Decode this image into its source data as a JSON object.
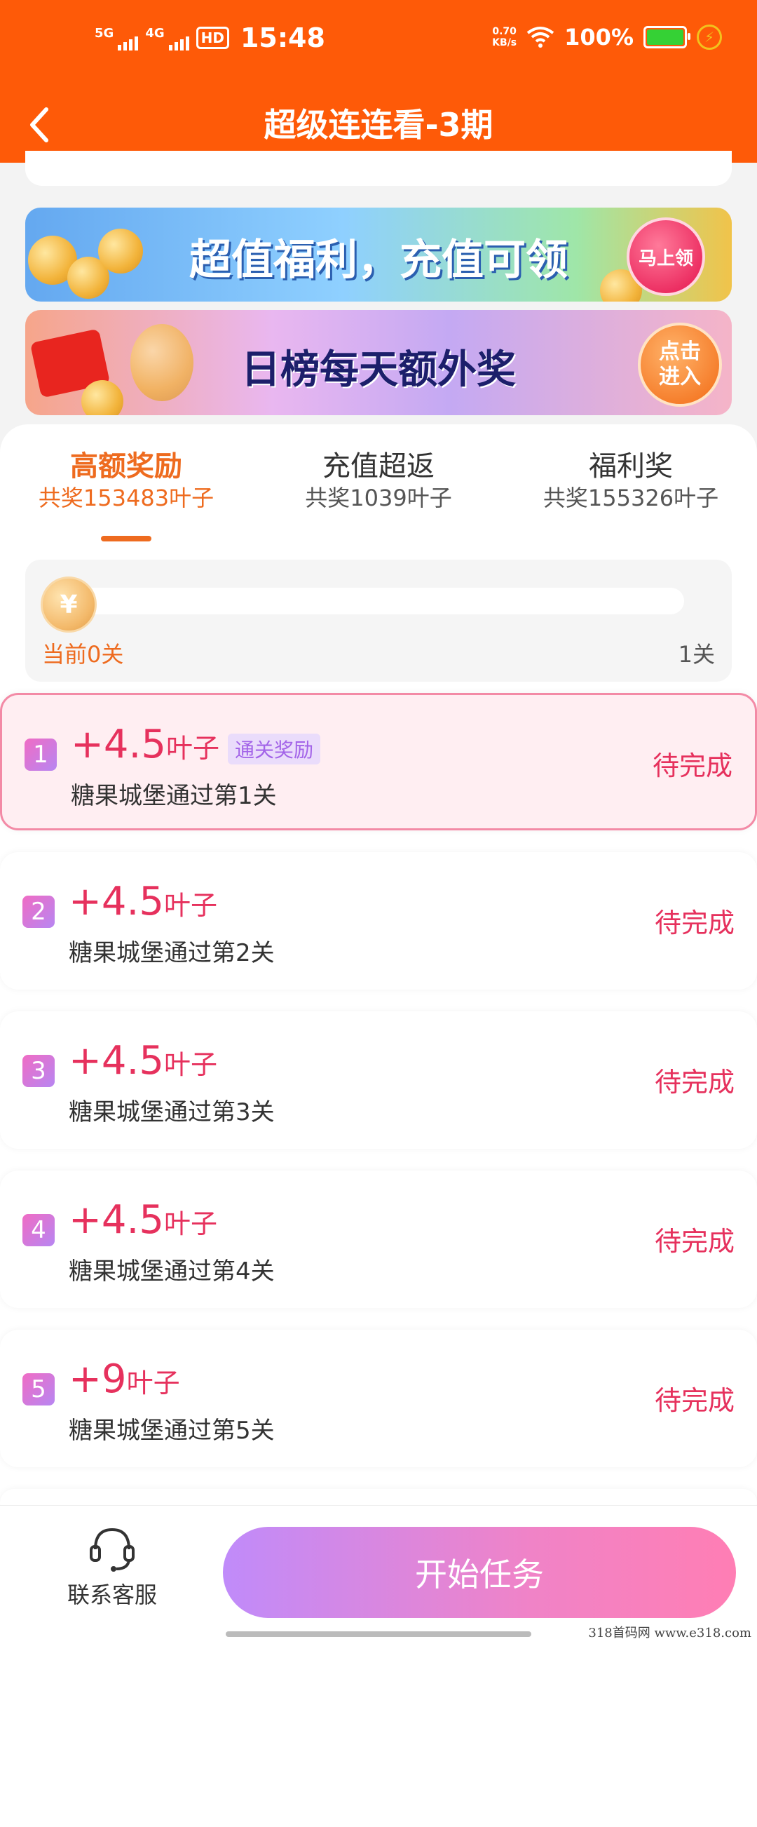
{
  "status_bar": {
    "net1": "5G",
    "net2": "4G",
    "hd": "HD",
    "time": "15:48",
    "speed_value": "0.70",
    "speed_unit": "KB/s",
    "battery": "100%"
  },
  "header": {
    "title": "超级连连看-3期"
  },
  "banners": [
    {
      "text": "超值福利，充值可领",
      "badge": "马上领"
    },
    {
      "text": "日榜每天额外奖",
      "badge_line1": "点击",
      "badge_line2": "进入"
    }
  ],
  "tabs": [
    {
      "label": "高额奖励",
      "sub": "共奖153483叶子"
    },
    {
      "label": "充值超返",
      "sub": "共奖1039叶子"
    },
    {
      "label": "福利奖",
      "sub": "共奖155326叶子"
    }
  ],
  "progress": {
    "current": "当前0关",
    "target": "1关",
    "coin_symbol": "¥",
    "fraction": 0
  },
  "tasks": [
    {
      "num": "1",
      "value": "+4.5",
      "unit": "叶子",
      "tag": "通关奖励",
      "desc": "糖果城堡通过第1关",
      "status": "待完成"
    },
    {
      "num": "2",
      "value": "+4.5",
      "unit": "叶子",
      "desc": "糖果城堡通过第2关",
      "status": "待完成"
    },
    {
      "num": "3",
      "value": "+4.5",
      "unit": "叶子",
      "desc": "糖果城堡通过第3关",
      "status": "待完成"
    },
    {
      "num": "4",
      "value": "+4.5",
      "unit": "叶子",
      "desc": "糖果城堡通过第4关",
      "status": "待完成"
    },
    {
      "num": "5",
      "value": "+9",
      "unit": "叶子",
      "desc": "糖果城堡通过第5关",
      "status": "待完成"
    }
  ],
  "bottom": {
    "service": "联系客服",
    "start": "开始任务"
  },
  "watermark": "318首码网  www.e318.com",
  "colors": {
    "header": "#fe5a08",
    "accent": "#ee6b1f",
    "reward": "#e6315d"
  }
}
